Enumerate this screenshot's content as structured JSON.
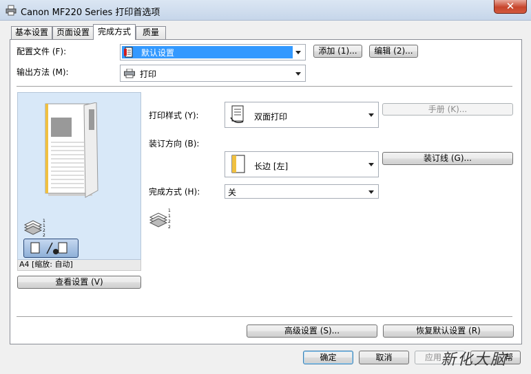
{
  "window": {
    "title": "Canon MF220 Series 打印首选项",
    "close_label": "✕"
  },
  "tabs": [
    {
      "label": "基本设置"
    },
    {
      "label": "页面设置"
    },
    {
      "label": "完成方式"
    },
    {
      "label": "质量"
    }
  ],
  "profile": {
    "label": "配置文件 (F):",
    "value": "默认设置",
    "add_button": "添加 (1)...",
    "edit_button": "编辑 (2)..."
  },
  "output": {
    "label": "输出方法 (M):",
    "value": "打印"
  },
  "preview": {
    "paper_status": "A4 [缩放: 自动]",
    "view_settings_button": "查看设置 (V)"
  },
  "finishing": {
    "print_style_label": "打印样式 (Y):",
    "print_style_value": "双面打印",
    "booklet_button": "手册 (K)...",
    "binding_label": "装订方向 (B):",
    "binding_value": "长边 [左]",
    "gutter_button": "装订线 (G)...",
    "finish_label": "完成方式 (H):",
    "finish_value": "关"
  },
  "bottom_buttons": {
    "advanced": "高级设置 (S)...",
    "restore": "恢复默认设置 (R)"
  },
  "dialog_buttons": {
    "ok": "确定",
    "cancel": "取消",
    "apply": "应用",
    "help": "帮"
  },
  "watermark": "新化大脑"
}
